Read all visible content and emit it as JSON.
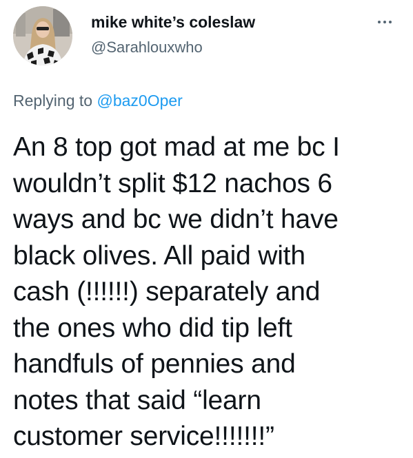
{
  "author": {
    "display_name": "mike white’s coleslaw",
    "handle": "@Sarahlouxwho"
  },
  "reply": {
    "prefix": "Replying to",
    "mention": "@baz0Oper"
  },
  "tweet": {
    "lines": [
      "An 8 top got mad at me bc I",
      "wouldn’t split $12 nachos 6",
      "ways and bc we didn’t have",
      "black olives. All paid with",
      "cash (!!!!!!) separately and",
      "the ones who did tip left",
      "handfuls of pennies and",
      "notes that said “learn",
      "customer service!!!!!!!”"
    ]
  },
  "icons": {
    "more": "more-horizontal-icon"
  },
  "colors": {
    "text": "#0f1419",
    "secondary": "#536471",
    "link": "#1d9bf0"
  }
}
